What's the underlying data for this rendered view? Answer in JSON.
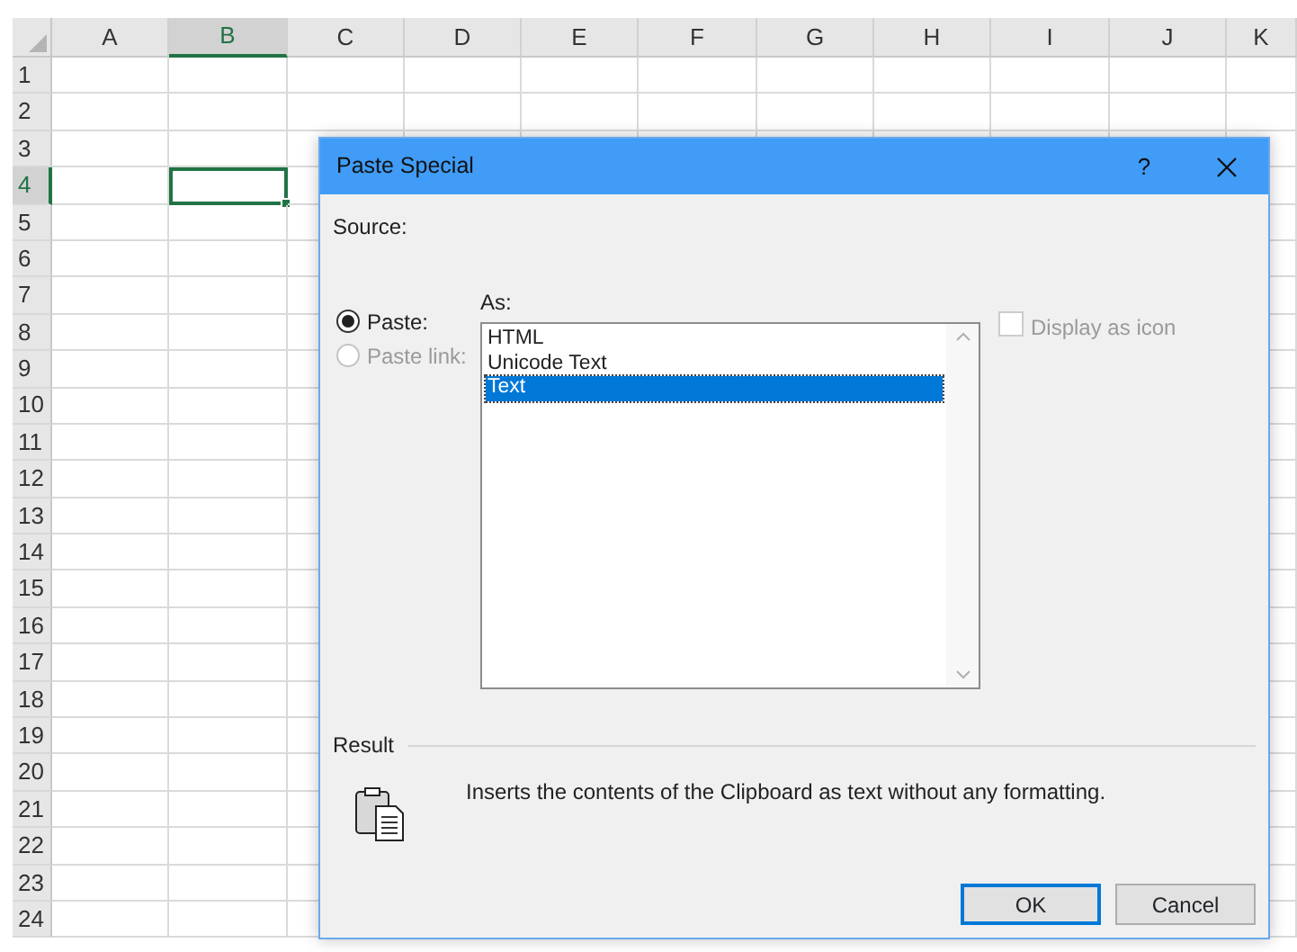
{
  "spreadsheet": {
    "columns": [
      {
        "label": "A",
        "selected": false
      },
      {
        "label": "B",
        "selected": true
      },
      {
        "label": "C",
        "selected": false
      },
      {
        "label": "D",
        "selected": false
      },
      {
        "label": "E",
        "selected": false
      },
      {
        "label": "F",
        "selected": false
      },
      {
        "label": "G",
        "selected": false
      },
      {
        "label": "H",
        "selected": false
      },
      {
        "label": "I",
        "selected": false
      },
      {
        "label": "J",
        "selected": false
      },
      {
        "label": "K",
        "selected": false
      }
    ],
    "rows": [
      {
        "label": "1",
        "selected": false
      },
      {
        "label": "2",
        "selected": false
      },
      {
        "label": "3",
        "selected": false
      },
      {
        "label": "4",
        "selected": true
      },
      {
        "label": "5",
        "selected": false
      },
      {
        "label": "6",
        "selected": false
      },
      {
        "label": "7",
        "selected": false
      },
      {
        "label": "8",
        "selected": false
      },
      {
        "label": "9",
        "selected": false
      },
      {
        "label": "10",
        "selected": false
      },
      {
        "label": "11",
        "selected": false
      },
      {
        "label": "12",
        "selected": false
      },
      {
        "label": "13",
        "selected": false
      },
      {
        "label": "14",
        "selected": false
      },
      {
        "label": "15",
        "selected": false
      },
      {
        "label": "16",
        "selected": false
      },
      {
        "label": "17",
        "selected": false
      },
      {
        "label": "18",
        "selected": false
      },
      {
        "label": "19",
        "selected": false
      },
      {
        "label": "20",
        "selected": false
      },
      {
        "label": "21",
        "selected": false
      },
      {
        "label": "22",
        "selected": false
      },
      {
        "label": "23",
        "selected": false
      },
      {
        "label": "24",
        "selected": false
      }
    ]
  },
  "dialog": {
    "title": "Paste Special",
    "help_button": "?",
    "source_label": "Source:",
    "as_label": "As:",
    "paste_options": [
      {
        "label": "Paste:",
        "selected": true,
        "disabled": false
      },
      {
        "label": "Paste link:",
        "selected": false,
        "disabled": true
      }
    ],
    "formats": [
      {
        "label": "HTML",
        "selected": false
      },
      {
        "label": "Unicode Text",
        "selected": false
      },
      {
        "label": "Text",
        "selected": true
      }
    ],
    "display_as_icon": {
      "label": "Display as icon",
      "checked": false,
      "disabled": true
    },
    "result": {
      "label": "Result",
      "description": "Inserts the contents of the Clipboard as text without any formatting."
    },
    "buttons": [
      {
        "label": "OK",
        "default": true
      },
      {
        "label": "Cancel",
        "default": false
      }
    ]
  }
}
